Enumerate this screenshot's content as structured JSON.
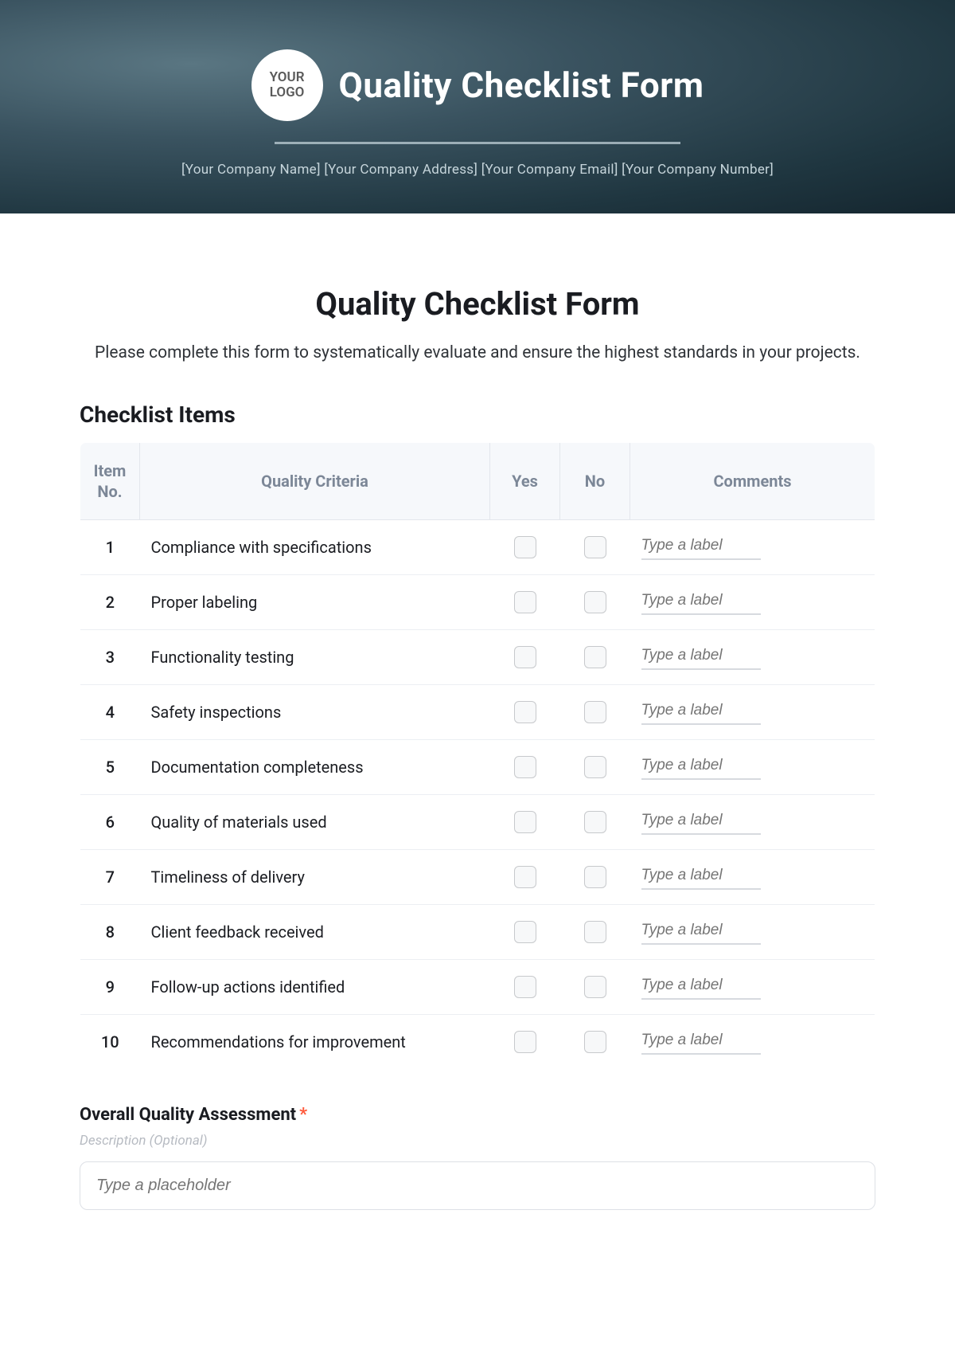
{
  "banner": {
    "logo_line1": "YOUR",
    "logo_line2": "LOGO",
    "title": "Quality Checklist Form",
    "sub": "[Your Company Name] [Your Company Address] [Your Company Email] [Your Company Number]"
  },
  "form": {
    "title": "Quality Checklist Form",
    "description": "Please complete this form to systematically evaluate and ensure the highest standards in your projects.",
    "section_heading": "Checklist Items"
  },
  "table": {
    "headers": {
      "itemno": "Item No.",
      "criteria": "Quality Criteria",
      "yes": "Yes",
      "no": "No",
      "comments": "Comments"
    },
    "comment_placeholder": "Type a label",
    "rows": [
      {
        "no": "1",
        "criteria": "Compliance with specifications"
      },
      {
        "no": "2",
        "criteria": "Proper labeling"
      },
      {
        "no": "3",
        "criteria": "Functionality testing"
      },
      {
        "no": "4",
        "criteria": "Safety inspections"
      },
      {
        "no": "5",
        "criteria": "Documentation completeness"
      },
      {
        "no": "6",
        "criteria": "Quality of materials used"
      },
      {
        "no": "7",
        "criteria": "Timeliness of delivery"
      },
      {
        "no": "8",
        "criteria": "Client feedback received"
      },
      {
        "no": "9",
        "criteria": "Follow-up actions identified"
      },
      {
        "no": "10",
        "criteria": "Recommendations for improvement"
      }
    ]
  },
  "assessment": {
    "label": "Overall Quality Assessment",
    "required_marker": "*",
    "description": "Description (Optional)",
    "placeholder": "Type a placeholder"
  }
}
